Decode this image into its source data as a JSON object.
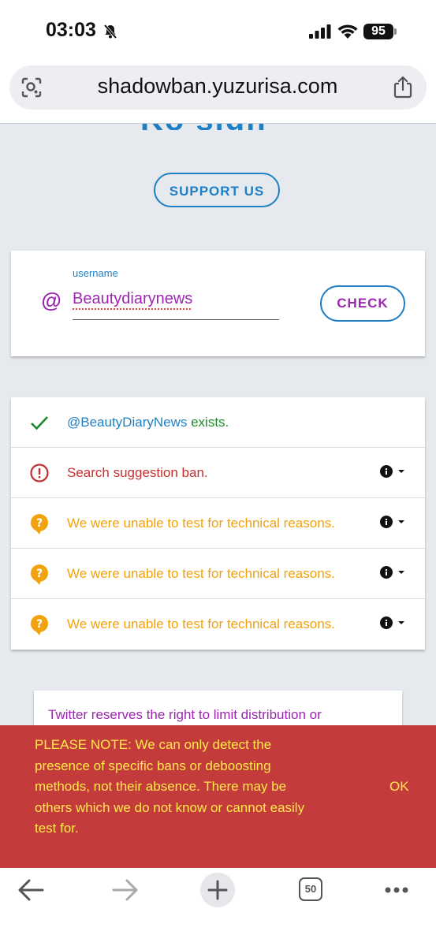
{
  "status": {
    "time": "03:03",
    "battery": "95"
  },
  "browser": {
    "url": "shadowban.yuzurisa.com",
    "tab_count": "50"
  },
  "page": {
    "logo_partial": "Ko sign",
    "support_label": "SUPPORT US",
    "form": {
      "label": "username",
      "at_symbol": "@",
      "value": "Beautydiarynews",
      "check_label": "CHECK"
    },
    "results": [
      {
        "status": "ok",
        "handle": "@BeautyDiaryNews",
        "text": " exists."
      },
      {
        "status": "ban",
        "text": "Search suggestion ban."
      },
      {
        "status": "unknown",
        "text": "We were unable to test for technical reasons."
      },
      {
        "status": "unknown",
        "text": "We were unable to test for technical reasons."
      },
      {
        "status": "unknown",
        "text": "We were unable to test for technical reasons."
      }
    ],
    "note": "Twitter reserves the right to limit distribution or"
  },
  "banner": {
    "text": "PLEASE NOTE: We can only detect the presence of specific bans or deboosting methods, not their absence. There may be others which we do not know or cannot easily test for.",
    "ok_label": "OK"
  },
  "colors": {
    "blue": "#1f7fc4",
    "purple": "#9b27af",
    "green": "#1e8a2c",
    "red": "#c62f2f",
    "orange": "#f2a20f",
    "banner": "#c43b3c",
    "banner_text": "#ffe94a"
  }
}
